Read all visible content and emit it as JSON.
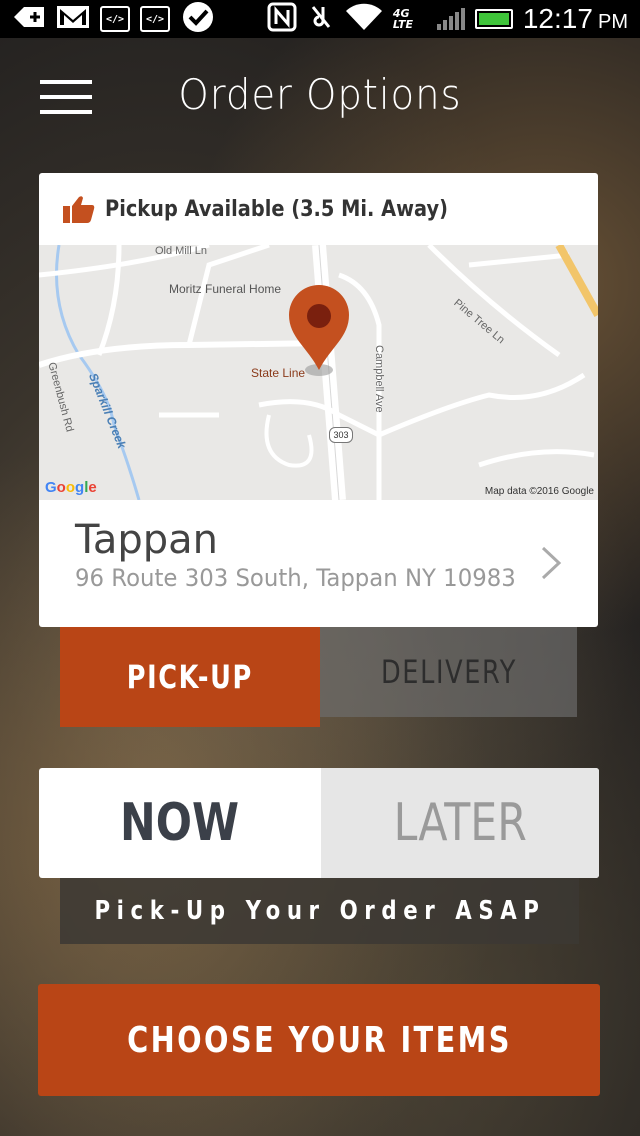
{
  "status_bar": {
    "time": "12:17",
    "ampm": "PM",
    "network": "4G LTE",
    "icons": [
      "add-icon",
      "gmail-icon",
      "code-icon",
      "code-icon",
      "check-bubble-icon",
      "nfc-icon",
      "mute-icon",
      "wifi-icon",
      "signal-icon",
      "battery-charging-icon"
    ]
  },
  "header": {
    "title": "Order Options",
    "menu_icon": "hamburger-menu-icon"
  },
  "location_card": {
    "pickup_status": "Pickup Available (3.5 Mi. Away)",
    "status_icon": "thumbs-up-icon",
    "map": {
      "labels": {
        "old_mill": "Old Mill Ln",
        "funeral_home": "Moritz Funeral Home",
        "pine_tree": "Pine Tree Ln",
        "campbell": "Campbell Ave",
        "greenbush": "Greenbush Rd",
        "creek": "Sparkill Creek",
        "state_line": "State Line",
        "route": "303"
      },
      "google_logo": "Google",
      "copyright": "Map data ©2016 Google"
    },
    "name": "Tappan",
    "address": "96 Route 303 South, Tappan NY 10983"
  },
  "order_mode": {
    "pickup_label": "PICK-UP",
    "delivery_label": "DELIVERY",
    "selected": "PICK-UP"
  },
  "order_time": {
    "now_label": "NOW",
    "later_label": "LATER",
    "selected": "NOW",
    "description": "Pick-Up Your Order ASAP"
  },
  "cta": {
    "label": "CHOOSE YOUR ITEMS"
  },
  "colors": {
    "accent": "#b94516",
    "map_pin": "#c4501f",
    "text_dark": "#3b4049"
  }
}
